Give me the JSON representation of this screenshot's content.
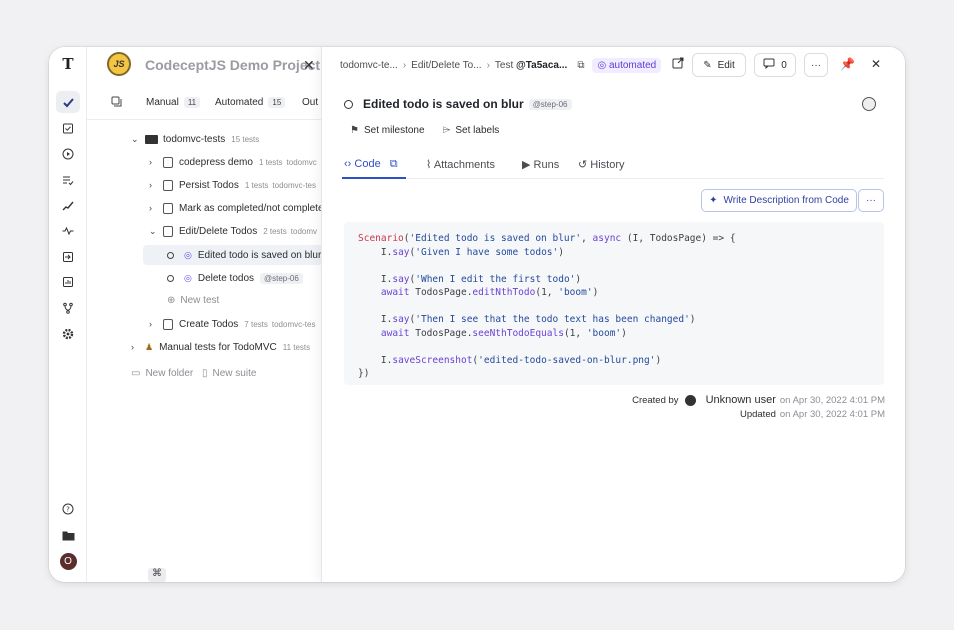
{
  "rail": {
    "logo": "T",
    "icons": [
      "check-icon",
      "clipboard-check-icon",
      "play-circle-icon",
      "list-check-icon",
      "trend-icon",
      "pulse-icon",
      "import-icon",
      "chart-icon",
      "branch-icon",
      "gear-icon",
      "help-icon",
      "folder-icon"
    ],
    "avatar_letter": "O"
  },
  "project": {
    "logo_text": "JS",
    "title": "CodeceptJS Demo Project"
  },
  "left_tabs": [
    {
      "label": "Manual",
      "count": "11"
    },
    {
      "label": "Automated",
      "count": "15"
    },
    {
      "label": "Out"
    }
  ],
  "tree": {
    "suite_folder": {
      "label": "todomvc-tests",
      "meta": "15 tests"
    },
    "suites": [
      {
        "label": "codepress demo",
        "meta": "1 tests",
        "meta2": "todomvc"
      },
      {
        "label": "Persist Todos",
        "meta": "1 tests",
        "meta2": "todomvc-tes"
      },
      {
        "label": "Mark as completed/not completed",
        "meta": "",
        "meta2": ""
      },
      {
        "label": "Edit/Delete Todos",
        "meta": "2 tests",
        "meta2": "todomv"
      }
    ],
    "tests": [
      {
        "label": "Edited todo is saved on blur",
        "tag": ""
      },
      {
        "label": "Delete todos",
        "tag": "@step-06"
      }
    ],
    "new_test": "New test",
    "suite_after": {
      "label": "Create Todos",
      "meta": "7 tests",
      "meta2": "todomvc-tes"
    },
    "manual_folder": {
      "label": "Manual tests for TodoMVC",
      "meta": "11 tests"
    },
    "new_folder": "New folder",
    "new_suite": "New suite"
  },
  "cmd_key": "⌘",
  "detail": {
    "breadcrumbs": [
      "todomvc-te...",
      "Edit/Delete To...",
      "Test"
    ],
    "test_id": "@Ta5aca...",
    "badge": "automated",
    "edit_label": "Edit",
    "comments_count": "0",
    "title": "Edited todo is saved on blur",
    "title_tag": "@step-06",
    "set_milestone": "Set milestone",
    "set_labels": "Set labels",
    "tabs": [
      "Code",
      "Attachments",
      "Runs",
      "History"
    ],
    "write_description": "Write Description from Code",
    "created_by_label": "Created by",
    "created_by_user": "Unknown user",
    "created_on": "on Apr 30, 2022 4:01 PM",
    "updated_label": "Updated",
    "updated_on": "on Apr 30, 2022 4:01 PM"
  },
  "code": {
    "l1_fn": "Scenario",
    "l1_str": "'Edited todo is saved on blur'",
    "l1_kw": "async",
    "l1_args": " (I, TodosPage) => {",
    "l2_obj": "I.",
    "l2_fn": "say",
    "l2_str": "'Given I have some todos'",
    "l3_obj": "I.",
    "l3_fn": "say",
    "l3_str": "'When I edit the first todo'",
    "l4_kw": "await",
    "l4_obj": " TodosPage.",
    "l4_fn": "editNthTodo",
    "l4_args": "(1, ",
    "l4_str": "'boom'",
    "l5_obj": "I.",
    "l5_fn": "say",
    "l5_str": "'Then I see that the todo text has been changed'",
    "l6_kw": "await",
    "l6_obj": " TodosPage.",
    "l6_fn": "seeNthTodoEquals",
    "l6_args": "(1, ",
    "l6_str": "'boom'",
    "l7_obj": "I.",
    "l7_fn": "saveScreenshot",
    "l7_str": "'edited-todo-saved-on-blur.png'",
    "l8": "})"
  }
}
